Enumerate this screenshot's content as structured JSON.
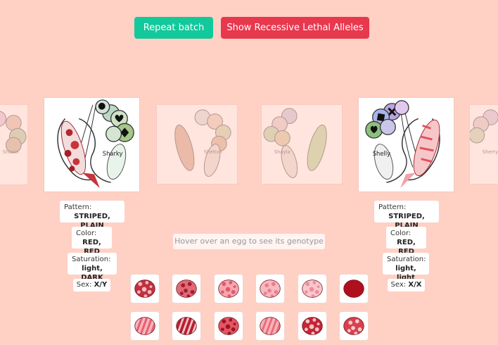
{
  "toolbar": {
    "repeat_label": "Repeat batch",
    "lethal_label": "Show Recessive Lethal Alleles"
  },
  "dragons": [
    {
      "name": "Shawn"
    },
    {
      "name": "Sharky"
    },
    {
      "name": "Shelton"
    },
    {
      "name": "Shayla"
    },
    {
      "name": "Shelly"
    },
    {
      "name": "Sherry"
    }
  ],
  "parents": {
    "left": {
      "pattern_label": "Pattern:",
      "pattern": "STRIPED, PLAIN",
      "color_label": "Color:",
      "color": "RED, RED",
      "saturation_label": "Saturation:",
      "saturation": "light, DARK",
      "sex_label": "Sex:",
      "sex": "X/Y"
    },
    "right": {
      "pattern_label": "Pattern:",
      "pattern": "STRIPED, PLAIN",
      "color_label": "Color:",
      "color": "RED, RED",
      "saturation_label": "Saturation:",
      "saturation": "light, light",
      "sex_label": "Sex:",
      "sex": "X/X"
    }
  },
  "hint": "Hover over an egg to see its genotype",
  "eggs": [
    {
      "pattern": "spotted",
      "base": "#c0303e",
      "spots": "#f4b8bf"
    },
    {
      "pattern": "spotted",
      "base": "#e06a77",
      "spots": "#a01e2e"
    },
    {
      "pattern": "spotted",
      "base": "#f6a8b2",
      "spots": "#e35868"
    },
    {
      "pattern": "spotted",
      "base": "#f7b9c0",
      "spots": "#ec7d8b"
    },
    {
      "pattern": "spotted",
      "base": "#f9c7cd",
      "spots": "#ef8e9a"
    },
    {
      "pattern": "plain",
      "base": "#b0101e",
      "spots": "#b0101e"
    },
    {
      "pattern": "striped",
      "base": "#f7b4bc",
      "spots": "#e95c6c"
    },
    {
      "pattern": "striped",
      "base": "#b51f2d",
      "spots": "#f3c0c6"
    },
    {
      "pattern": "spotted",
      "base": "#e55564",
      "spots": "#9a1523"
    },
    {
      "pattern": "striped",
      "base": "#f8b3bb",
      "spots": "#ea6a78"
    },
    {
      "pattern": "spotted",
      "base": "#c52634",
      "spots": "#f6c4ca"
    },
    {
      "pattern": "spotted",
      "base": "#d8404e",
      "spots": "#f7c9ce"
    }
  ]
}
